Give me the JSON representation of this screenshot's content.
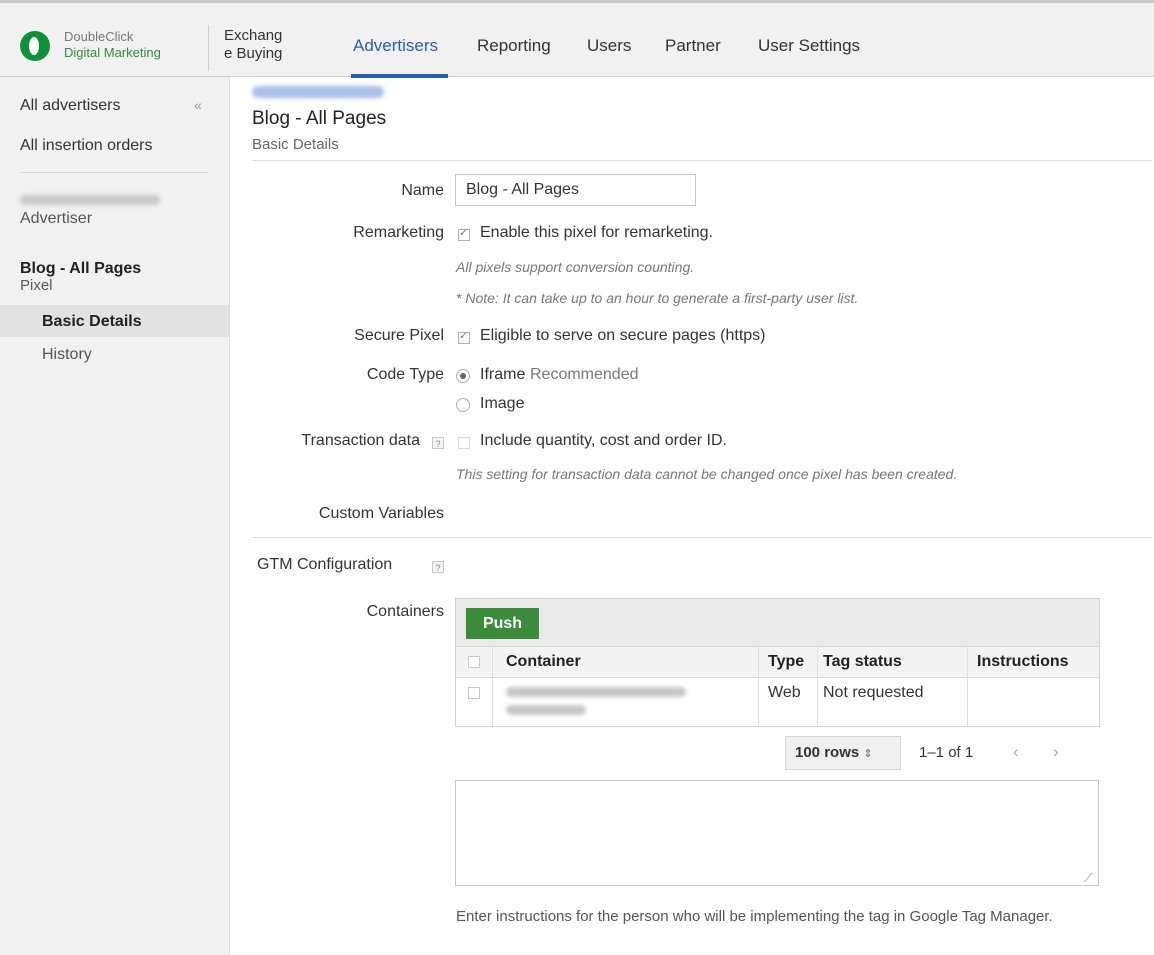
{
  "header": {
    "logo_line1": "DoubleClick",
    "logo_line2": "Digital Marketing",
    "exchange_line1": "Exchang",
    "exchange_line2": "e Buying",
    "nav": [
      "Advertisers",
      "Reporting",
      "Users",
      "Partner",
      "User Settings"
    ],
    "active_nav": "Advertisers"
  },
  "sidebar": {
    "all_advertisers": "All advertisers",
    "collapse": "«",
    "all_insertion_orders": "All insertion orders",
    "advertiser_label": "Advertiser",
    "pixel_name": "Blog - All Pages",
    "pixel_label": "Pixel",
    "basic_details": "Basic Details",
    "history": "History"
  },
  "main": {
    "title": "Blog - All Pages",
    "subtitle": "Basic Details",
    "name_label": "Name",
    "name_value": "Blog - All Pages",
    "remarketing_label": "Remarketing",
    "remarketing_option": "Enable this pixel for remarketing.",
    "remarketing_hint1": "All pixels support conversion counting.",
    "remarketing_hint2": "* Note: It can take up to an hour to generate a first-party user list.",
    "secure_label": "Secure Pixel",
    "secure_option": "Eligible to serve on secure pages (https)",
    "code_type_label": "Code Type",
    "code_type_iframe": "Iframe",
    "code_type_recommended": "Recommended",
    "code_type_image": "Image",
    "transaction_label": "Transaction data",
    "transaction_option": "Include quantity, cost and order ID.",
    "transaction_hint": "This setting for transaction data cannot be changed once pixel has been created.",
    "custom_variables_label": "Custom Variables",
    "gtm_label": "GTM Configuration",
    "containers_label": "Containers",
    "help_glyph": "?"
  },
  "table": {
    "push_label": "Push",
    "columns": [
      "Container",
      "Type",
      "Tag status",
      "Instructions"
    ],
    "rows": [
      {
        "type": "Web",
        "tag_status": "Not requested"
      }
    ]
  },
  "pager": {
    "rows_label": "100 rows",
    "rows_icon": "⇕",
    "range": "1–1 of 1",
    "prev": "‹",
    "next": "›"
  },
  "instructions_hint": "Enter instructions for the person who will be implementing the tag in Google Tag Manager."
}
